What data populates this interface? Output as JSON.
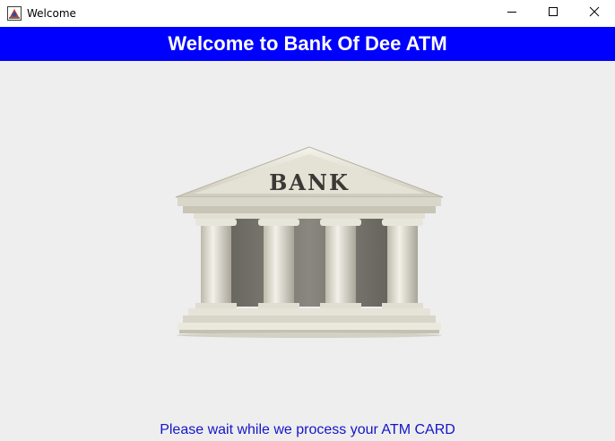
{
  "window": {
    "title": "Welcome",
    "icons": {
      "app": "java-app-icon",
      "minimize": "minimize-icon",
      "maximize": "maximize-icon",
      "close": "close-icon"
    }
  },
  "banner": {
    "text": "Welcome to Bank Of Dee ATM",
    "background": "#0000ff",
    "color": "#ffffff"
  },
  "illustration": {
    "label": "BANK",
    "icon": "bank-building-icon"
  },
  "status": {
    "text": "Please wait while we process your ATM CARD",
    "color": "#1515c8"
  }
}
